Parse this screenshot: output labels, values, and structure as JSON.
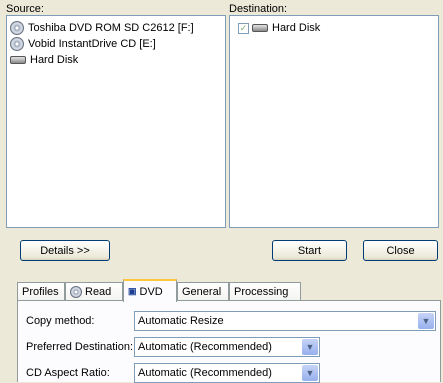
{
  "source": {
    "label": "Source:",
    "items": [
      {
        "label": "Toshiba DVD ROM SD C2612 [F:]",
        "icon": "cd-icon"
      },
      {
        "label": "Vobid InstantDrive CD [E:]",
        "icon": "cd-icon"
      },
      {
        "label": "Hard Disk",
        "icon": "hard-disk-icon"
      }
    ]
  },
  "destination": {
    "label": "Destination:",
    "items": [
      {
        "label": "Hard Disk",
        "icon": "hard-disk-icon",
        "checked": true
      }
    ]
  },
  "buttons": {
    "details": "Details >>",
    "start": "Start",
    "close": "Close"
  },
  "tabs": [
    "Profiles",
    "Read",
    "DVD",
    "General",
    "Processing"
  ],
  "active_tab": "DVD",
  "settings": [
    {
      "label": "Copy method:",
      "value": "Automatic Resize"
    },
    {
      "label": "Preferred Destination:",
      "value": "Automatic (Recommended)"
    },
    {
      "label": "CD Aspect Ratio:",
      "value": "Automatic (Recommended)"
    }
  ],
  "colors": {
    "accent": "#ffc83c",
    "border": "#7f9db9",
    "background": "#ece9d8"
  }
}
